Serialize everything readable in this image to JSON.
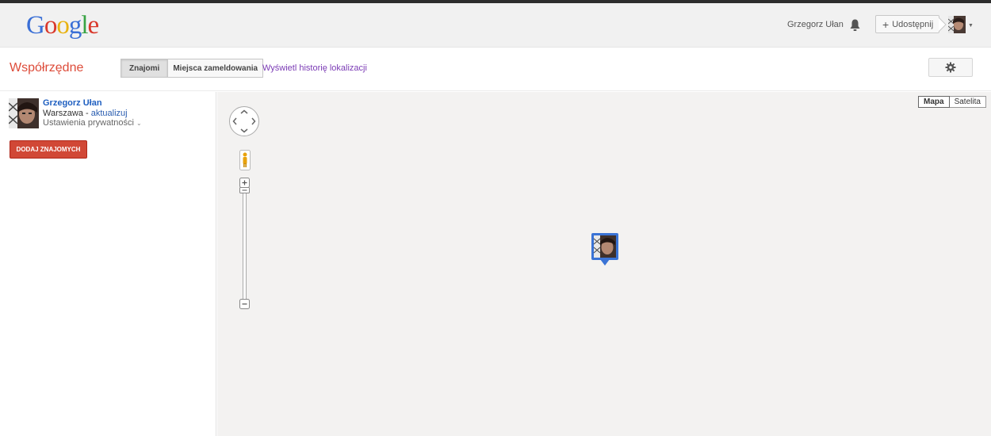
{
  "header": {
    "logo_text": "Google",
    "user_name": "Grzegorz Ułan",
    "share_label": "Udostępnij",
    "icons": [
      "bell-icon",
      "plus-icon",
      "avatar",
      "chevron-down-icon"
    ]
  },
  "toolbar": {
    "page_title": "Współrzędne",
    "tabs": [
      {
        "label": "Znajomi",
        "active": true
      },
      {
        "label": "Miejsca zameldowania",
        "active": false
      }
    ],
    "history_link": "Wyświetl historię lokalizacji",
    "settings_icon": "gear-icon"
  },
  "sidebar": {
    "user": {
      "name": "Grzegorz Ułan",
      "location": "Warszawa",
      "separator": " - ",
      "update_link": "aktualizuj",
      "privacy_label": "Ustawienia prywatności",
      "privacy_caret": "⌄"
    },
    "add_friends_label": "DODAJ ZNAJOMYCH"
  },
  "map": {
    "map_types": [
      {
        "label": "Mapa",
        "active": true
      },
      {
        "label": "Satelita",
        "active": false
      }
    ],
    "controls": [
      "pan-control",
      "pegman-icon",
      "zoom-in-button",
      "zoom-out-button"
    ],
    "accent_color": "#3a73d5"
  }
}
